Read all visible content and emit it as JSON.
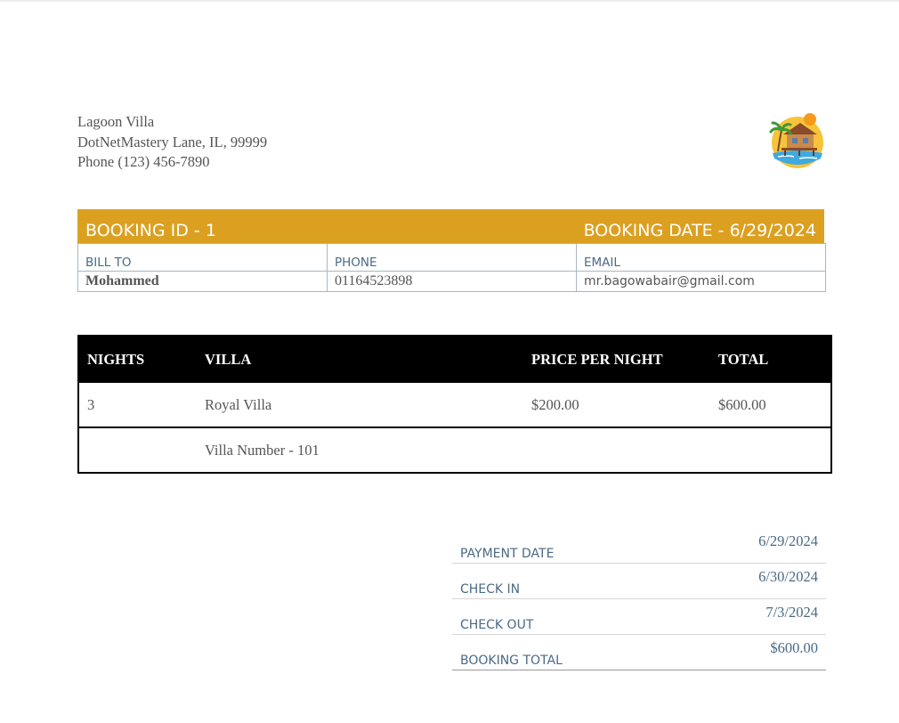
{
  "company": {
    "name": "Lagoon Villa",
    "address": "DotNetMastery Lane, IL, 99999",
    "phone": "Phone (123) 456-7890"
  },
  "logo": {
    "icon": "beach-villa-logo-icon",
    "colors": {
      "sun": "#f5b82e",
      "water": "#3fa9e0",
      "hut": "#c98a4a"
    }
  },
  "booking": {
    "id_label": "BOOKING ID - 1",
    "date_label": "BOOKING DATE - 6/29/2024",
    "bar_color": "#dca021"
  },
  "bill": {
    "headers": {
      "bill_to": "BILL TO",
      "phone": "PHONE",
      "email": "EMAIL"
    },
    "values": {
      "name": "Mohammed",
      "phone": "01164523898",
      "email": "mr.bagowabair@gmail.com"
    }
  },
  "items": {
    "headers": {
      "nights": "NIGHTS",
      "villa": "VILLA",
      "price": "PRICE PER NIGHT",
      "total": "TOTAL"
    },
    "row": {
      "nights": "3",
      "villa": "Royal Villa",
      "price": "$200.00",
      "total": "$600.00"
    },
    "detail": {
      "villa_number": "Villa Number - 101"
    }
  },
  "summary": {
    "payment_date": {
      "label": "PAYMENT DATE",
      "value": "6/29/2024"
    },
    "check_in": {
      "label": "CHECK IN",
      "value": "6/30/2024"
    },
    "check_out": {
      "label": "CHECK OUT",
      "value": "7/3/2024"
    },
    "booking_total": {
      "label": "BOOKING TOTAL",
      "value": "$600.00"
    }
  }
}
